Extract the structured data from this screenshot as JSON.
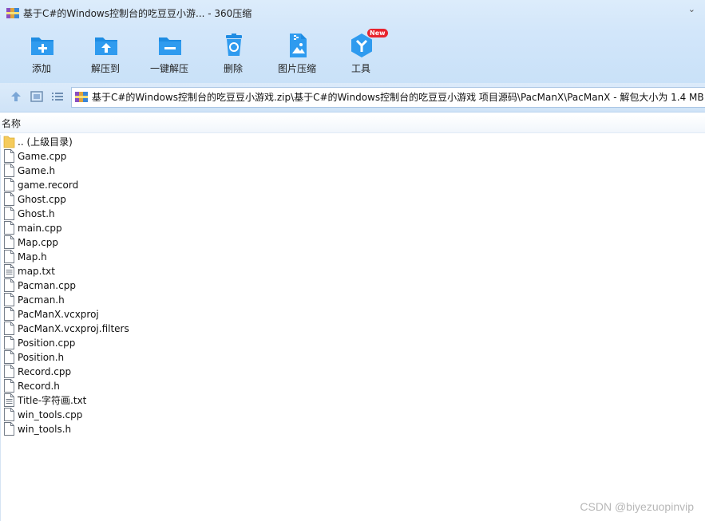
{
  "window": {
    "title": "基于C#的Windows控制台的吃豆豆小游... - 360压缩"
  },
  "toolbar": {
    "items": [
      {
        "label": "添加",
        "icon": "add-archive-icon"
      },
      {
        "label": "解压到",
        "icon": "extract-to-icon"
      },
      {
        "label": "一键解压",
        "icon": "one-click-extract-icon"
      },
      {
        "label": "删除",
        "icon": "delete-icon"
      },
      {
        "label": "图片压缩",
        "icon": "image-compress-icon"
      },
      {
        "label": "工具",
        "icon": "tools-icon",
        "badge": "New"
      }
    ]
  },
  "address": {
    "path": "基于C#的Windows控制台的吃豆豆小游戏.zip\\基于C#的Windows控制台的吃豆豆小游戏 项目源码\\PacManX\\PacManX - 解包大小为 1.4 MB"
  },
  "columns": {
    "name": "名称"
  },
  "files": [
    {
      "name": ".. (上级目录)",
      "type": "folder"
    },
    {
      "name": "Game.cpp",
      "type": "file"
    },
    {
      "name": "Game.h",
      "type": "file"
    },
    {
      "name": "game.record",
      "type": "file"
    },
    {
      "name": "Ghost.cpp",
      "type": "file"
    },
    {
      "name": "Ghost.h",
      "type": "file"
    },
    {
      "name": "main.cpp",
      "type": "file"
    },
    {
      "name": "Map.cpp",
      "type": "file"
    },
    {
      "name": "Map.h",
      "type": "file"
    },
    {
      "name": "map.txt",
      "type": "text"
    },
    {
      "name": "Pacman.cpp",
      "type": "file"
    },
    {
      "name": "Pacman.h",
      "type": "file"
    },
    {
      "name": "PacManX.vcxproj",
      "type": "file"
    },
    {
      "name": "PacManX.vcxproj.filters",
      "type": "file"
    },
    {
      "name": "Position.cpp",
      "type": "file"
    },
    {
      "name": "Position.h",
      "type": "file"
    },
    {
      "name": "Record.cpp",
      "type": "file"
    },
    {
      "name": "Record.h",
      "type": "file"
    },
    {
      "name": "Title-字符画.txt",
      "type": "text"
    },
    {
      "name": "win_tools.cpp",
      "type": "file"
    },
    {
      "name": "win_tools.h",
      "type": "file"
    }
  ],
  "watermark": "CSDN @biyezuopinvip",
  "colors": {
    "accent": "#1e8ce3",
    "chrome": "#d2e6fa",
    "folder": "#f5cb5c",
    "badge": "#e8232d"
  }
}
